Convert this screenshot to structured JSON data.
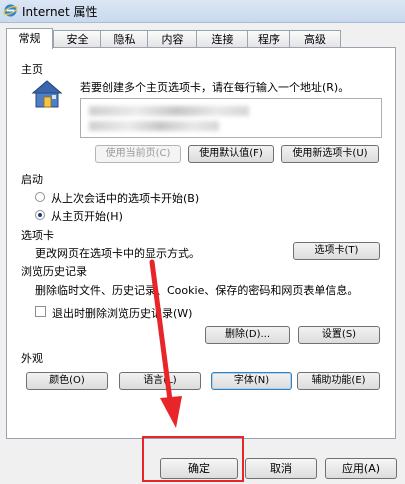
{
  "window": {
    "title": "Internet 属性"
  },
  "tabs": [
    "常规",
    "安全",
    "隐私",
    "内容",
    "连接",
    "程序",
    "高级"
  ],
  "homepage": {
    "section_title": "主页",
    "instruction": "若要创建多个主页选项卡，请在每行输入一个地址(R)。",
    "use_current_label": "使用当前页(C)",
    "use_default_label": "使用默认值(F)",
    "use_new_tab_label": "使用新选项卡(U)"
  },
  "startup": {
    "section_title": "启动",
    "option_last_session": "从上次会话中的选项卡开始(B)",
    "option_homepage": "从主页开始(H)",
    "selected": "option_homepage"
  },
  "tabs_section": {
    "section_title": "选项卡",
    "description": "更改网页在选项卡中的显示方式。",
    "tabs_button_label": "选项卡(T)"
  },
  "history": {
    "section_title": "浏览历史记录",
    "description": "删除临时文件、历史记录、Cookie、保存的密码和网页表单信息。",
    "delete_on_exit_label": "退出时删除浏览历史记录(W)",
    "delete_on_exit_checked": false,
    "delete_button_label": "删除(D)...",
    "settings_button_label": "设置(S)"
  },
  "appearance": {
    "section_title": "外观",
    "colors_label": "颜色(O)",
    "languages_label": "语言(L)",
    "fonts_label": "字体(N)",
    "accessibility_label": "辅助功能(E)"
  },
  "footer": {
    "ok_label": "确定",
    "cancel_label": "取消",
    "apply_label": "应用(A)"
  },
  "colors": {
    "annotation_red": "#e8262a",
    "radio_dot": "#1d3e76"
  }
}
